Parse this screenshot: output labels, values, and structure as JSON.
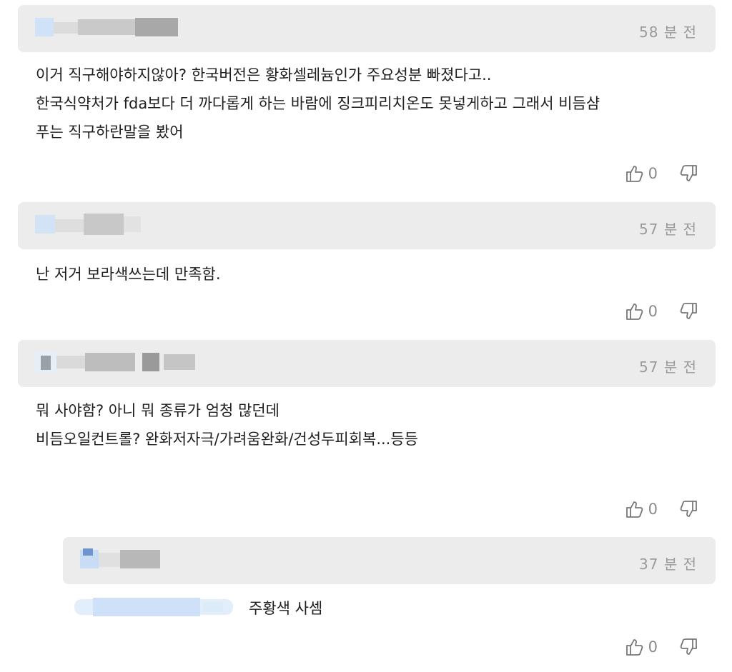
{
  "comments": [
    {
      "time": "58 분 전",
      "lines": [
        "이거 직구해야하지않아? 한국버전은 황화셀레늄인가 주요성분 빠졌다고..",
        "한국식약처가 fda보다 더 까다롭게 하는 바람에 징크피리치온도 못넣게하고 그래서 비듬샴",
        "푸는 직구하란말을 봤어"
      ],
      "likes": "0"
    },
    {
      "time": "57 분 전",
      "lines": [
        "난 저거 보라색쓰는데 만족함."
      ],
      "likes": "0"
    },
    {
      "time": "57 분 전",
      "lines": [
        "뭐 사야함? 아니 뭐 종류가 엄청 많던데",
        "비듬오일컨트롤? 완화저자극/가려움완화/건성두피회복...등등"
      ],
      "likes": "0"
    }
  ],
  "reply": {
    "time": "37 분 전",
    "text": "주황색 사셈",
    "likes": "0"
  },
  "colors": {
    "bar": "#ececec",
    "time": "#9a9a9a",
    "blur_blue": "#cfe0f5",
    "blur_gray": "#8c8c8c"
  }
}
